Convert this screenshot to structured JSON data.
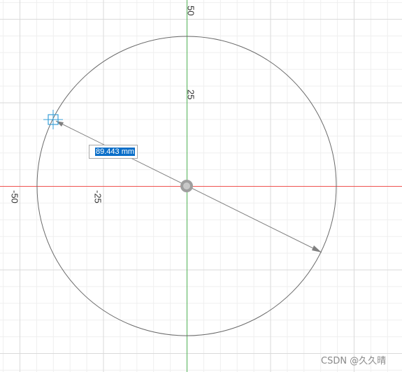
{
  "axis_labels": {
    "y_50": "50",
    "y_25": "25",
    "x_neg_25": "-25",
    "x_neg_50": "-50"
  },
  "dimension_input": {
    "value": "89.443 mm"
  },
  "watermark": "CSDN @久久晴",
  "colors": {
    "x_axis": "#ef5350",
    "y_axis": "#66bb6a",
    "grid_minor": "#eeeeee",
    "grid_major": "#dcdcdc",
    "circle": "#6a6a6a",
    "selection": "#0a6ec8",
    "cursor": "#3aa0d8"
  },
  "icons": {
    "origin": "origin-point-icon",
    "cursor": "sketch-cursor-icon",
    "arrow": "arrowhead-icon"
  }
}
